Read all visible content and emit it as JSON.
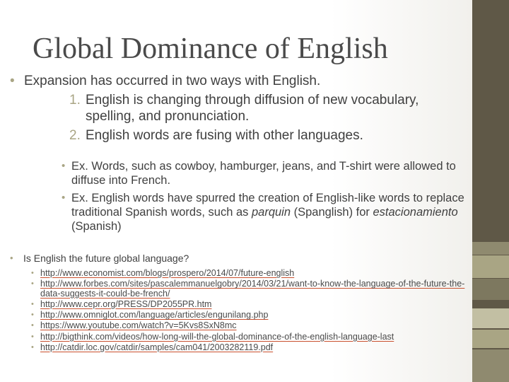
{
  "title": "Global Dominance of English",
  "main_bullet": "Expansion has occurred in two ways with English.",
  "numbered": [
    {
      "num": "1.",
      "text": "English is changing through diffusion of new vocabulary, spelling, and pronunciation."
    },
    {
      "num": "2.",
      "text": "English words are fusing with other languages."
    }
  ],
  "examples": {
    "ex1": "Ex. Words, such as cowboy, hamburger, jeans, and T-shirt were allowed to diffuse into French.",
    "ex2_start": "Ex. English words have spurred the creation of English-like words to replace traditional Spanish words, such as ",
    "ex2_term1": "parquin",
    "ex2_mid": " (Spanglish) for ",
    "ex2_term2": "estacionamiento",
    "ex2_end": " (Spanish)"
  },
  "question": "Is English the future global language?",
  "links": [
    "http://www.economist.com/blogs/prospero/2014/07/future-english",
    "http://www.forbes.com/sites/pascalemmanuelgobry/2014/03/21/want-to-know-the-language-of-the-future-the-data-suggests-it-could-be-french/",
    "http://www.cepr.org/PRESS/DP2055PR.htm",
    "http://www.omniglot.com/language/articles/engunilang.php",
    "https://www.youtube.com/watch?v=5Kvs8SxN8mc",
    "http://bigthink.com/videos/how-long-will-the-global-dominance-of-the-english-language-last",
    "http://catdir.loc.gov/catdir/samples/cam041/2003282119.pdf"
  ],
  "bullet_glyph": "•",
  "colors": {
    "accent": "#a9a584",
    "sidebar": "#5f5847",
    "text": "#404040",
    "link_underline": "#c94f2d"
  }
}
